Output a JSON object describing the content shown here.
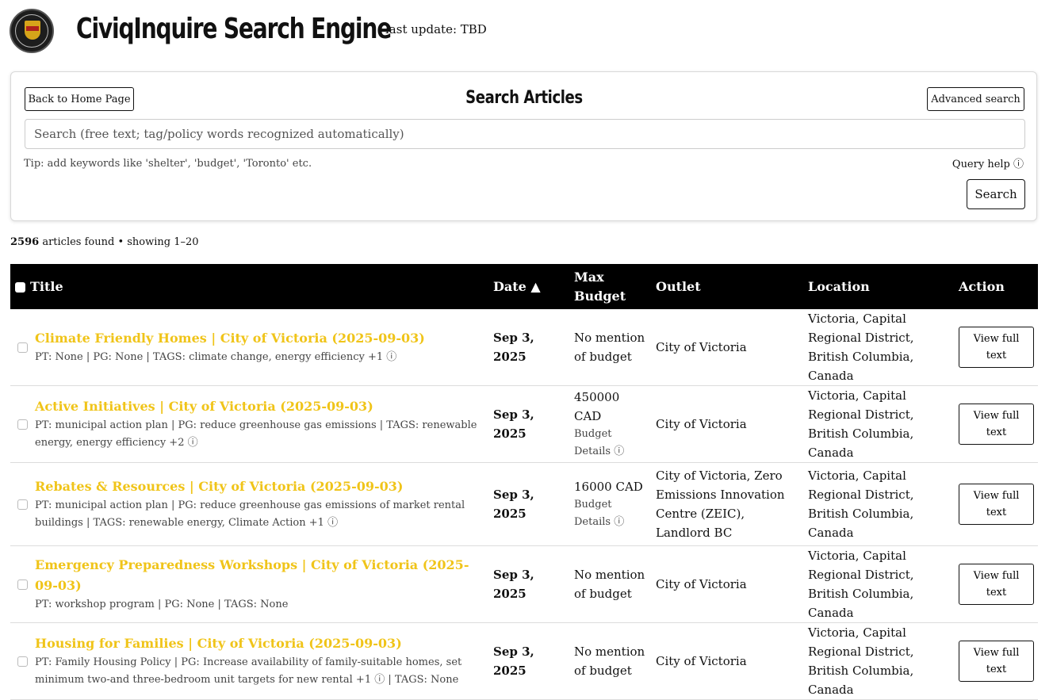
{
  "header": {
    "title": "CiviqInquire Search Engine",
    "last_update": "last update: TBD",
    "logo_icon": "university-seal"
  },
  "search": {
    "back_label": "Back to Home Page",
    "title": "Search Articles",
    "advanced_label": "Advanced search",
    "placeholder": "Search (free text; tag/policy words recognized automatically)",
    "tip": "Tip: add keywords like 'shelter', 'budget', 'Toronto' etc.",
    "query_help": "Query help ⓘ",
    "submit_label": "Search"
  },
  "results": {
    "count": "2596",
    "suffix": " articles found • showing 1–20"
  },
  "table": {
    "columns": {
      "title": "Title",
      "date": "Date ▲",
      "budget": "Max Budget",
      "outlet": "Outlet",
      "location": "Location",
      "action": "Action"
    },
    "rows": [
      {
        "title": "Climate Friendly Homes | City of Victoria (2025-09-03)",
        "meta": "PT: None | PG: None | TAGS: climate change, energy efficiency +1",
        "info": "ⓘ",
        "date": "Sep 3, 2025",
        "budget": "No mention of budget",
        "budget_details": "",
        "outlet": "City of Victoria",
        "location": "Victoria, Capital Regional District, British Columbia, Canada",
        "action": "View full text"
      },
      {
        "title": "Active Initiatives | City of Victoria (2025-09-03)",
        "meta": "PT: municipal action plan | PG: reduce greenhouse gas emissions | TAGS: renewable energy, energy efficiency +2",
        "info": "ⓘ",
        "date": "Sep 3, 2025",
        "budget": "450000 CAD",
        "budget_details": "Budget Details ⓘ",
        "outlet": "City of Victoria",
        "location": "Victoria, Capital Regional District, British Columbia, Canada",
        "action": "View full text"
      },
      {
        "title": "Rebates & Resources | City of Victoria (2025-09-03)",
        "meta": "PT: municipal action plan | PG: reduce greenhouse gas emissions of market rental buildings | TAGS: renewable energy, Climate Action +1",
        "info": "ⓘ",
        "date": "Sep 3, 2025",
        "budget": "16000 CAD",
        "budget_details": "Budget Details ⓘ",
        "outlet": "City of Victoria, Zero Emissions Innovation Centre (ZEIC), Landlord BC",
        "location": "Victoria, Capital Regional District, British Columbia, Canada",
        "action": "View full text"
      },
      {
        "title": "Emergency Preparedness Workshops | City of Victoria (2025-09-03)",
        "meta": "PT: workshop program | PG: None | TAGS: None",
        "info": "",
        "date": "Sep 3, 2025",
        "budget": "No mention of budget",
        "budget_details": "",
        "outlet": "City of Victoria",
        "location": "Victoria, Capital Regional District, British Columbia, Canada",
        "action": "View full text"
      },
      {
        "title": "Housing for Families | City of Victoria (2025-09-03)",
        "meta": "PT: Family Housing Policy | PG: Increase availability of family-suitable homes, set minimum two-and three-bedroom unit targets for new rental +1 ⓘ | TAGS: None",
        "info": "",
        "date": "Sep 3, 2025",
        "budget": "No mention of budget",
        "budget_details": "",
        "outlet": "City of Victoria",
        "location": "Victoria, Capital Regional District, British Columbia, Canada",
        "action": "View full text"
      }
    ]
  }
}
